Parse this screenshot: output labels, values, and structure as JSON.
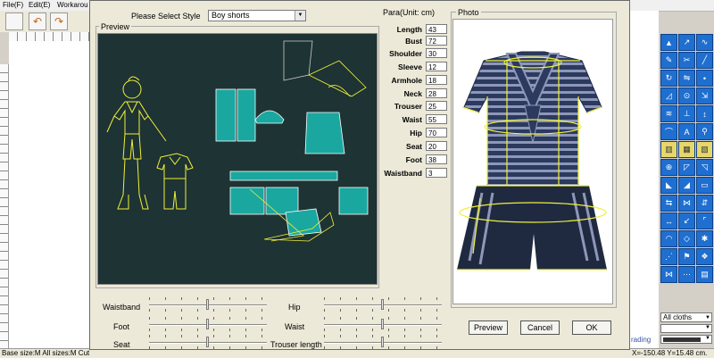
{
  "background_app": {
    "menu": [
      "File(F)",
      "Edit(E)",
      "Workarou"
    ],
    "status": "Base size:M All sizes:M Cut",
    "coords": "X=-150.48 Y=15.48 cm.",
    "grading_label": "rading",
    "size_dropdown": "All cloths"
  },
  "dialog": {
    "style_label": "Please Select Style",
    "style_value": "Boy shorts",
    "preview_title": "Preview",
    "para_title": "Para(Unit: cm)",
    "photo_title": "Photo",
    "params": [
      {
        "label": "Length",
        "value": "43"
      },
      {
        "label": "Bust",
        "value": "72"
      },
      {
        "label": "Shoulder",
        "value": "30"
      },
      {
        "label": "Sleeve",
        "value": "12"
      },
      {
        "label": "Armhole",
        "value": "18"
      },
      {
        "label": "Neck",
        "value": "28"
      },
      {
        "label": "Trouser",
        "value": "25"
      },
      {
        "label": "Waist",
        "value": "55"
      },
      {
        "label": "Hip",
        "value": "70"
      },
      {
        "label": "Seat",
        "value": "20"
      },
      {
        "label": "Foot",
        "value": "38"
      },
      {
        "label": "Waistband",
        "value": "3"
      }
    ],
    "sliders": {
      "waistband": "Waistband",
      "foot": "Foot",
      "seat": "Seat",
      "hip": "Hip",
      "waist": "Waist",
      "trouser_length": "Trouser length"
    },
    "buttons": {
      "preview": "Preview",
      "cancel": "Cancel",
      "ok": "OK"
    }
  },
  "colors": {
    "preview_bg": "#1e3333",
    "pattern_fill": "#1aa7a0",
    "outline": "#f0f03a",
    "shirt_navy": "#2b3a5e",
    "stripe": "#8e97b8",
    "tool_blue": "#1f6fd0"
  }
}
